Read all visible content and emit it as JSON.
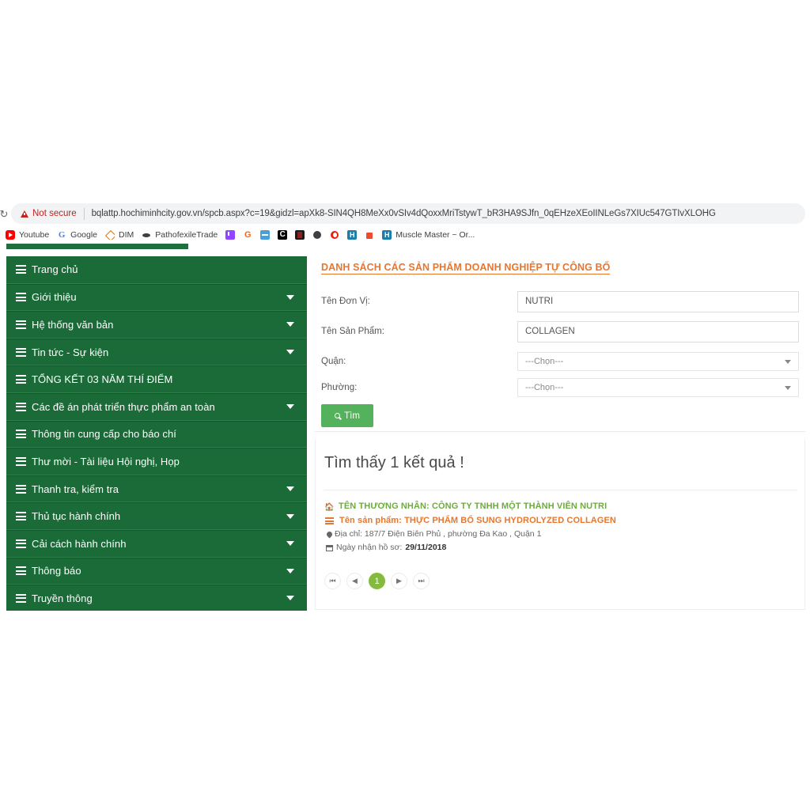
{
  "browser": {
    "reload_icon": "reload-icon",
    "security_label": "Not secure",
    "url": "bqlattp.hochiminhcity.gov.vn/spcb.aspx?c=19&gidzl=apXk8-SIN4QH8MeXx0vSIv4dQoxxMriTstywT_bR3HA9SJfn_0qEHzeXEoIINLeGs7XIUc547GTIvXLOHG",
    "bookmarks": [
      {
        "label": "Youtube",
        "icon": "youtube-icon",
        "cls": "fav-youtube",
        "glyph": ""
      },
      {
        "label": "Google",
        "icon": "google-icon",
        "cls": "fav-google",
        "glyph": "G"
      },
      {
        "label": "DIM",
        "icon": "dim-icon",
        "cls": "fav-dim",
        "glyph": ""
      },
      {
        "label": "PathofexileTrade",
        "icon": "pathofexile-icon",
        "cls": "fav-patho",
        "glyph": ""
      },
      {
        "label": "",
        "icon": "twitch-icon",
        "cls": "fav-twitch",
        "glyph": ""
      },
      {
        "label": "",
        "icon": "g2a-icon",
        "cls": "fav-g2",
        "glyph": "G"
      },
      {
        "label": "",
        "icon": "blue-site-icon",
        "cls": "fav-blue",
        "glyph": ""
      },
      {
        "label": "",
        "icon": "curseforge-icon",
        "cls": "fav-c",
        "glyph": "C"
      },
      {
        "label": "",
        "icon": "dark-site-icon",
        "cls": "fav-dark",
        "glyph": ""
      },
      {
        "label": "",
        "icon": "globe-icon",
        "cls": "fav-globe",
        "glyph": ""
      },
      {
        "label": "",
        "icon": "opera-icon",
        "cls": "fav-opera",
        "glyph": ""
      },
      {
        "label": "",
        "icon": "h-site-icon",
        "cls": "fav-h",
        "glyph": "H"
      },
      {
        "label": "",
        "icon": "shopee-icon",
        "cls": "fav-shopee",
        "glyph": ""
      },
      {
        "label": "Muscle Master ~ Or...",
        "icon": "h-site-icon-2",
        "cls": "fav-h2",
        "glyph": "H"
      }
    ]
  },
  "sidebar": {
    "items": [
      {
        "label": "Trang chủ",
        "has_caret": false
      },
      {
        "label": "Giới thiệu",
        "has_caret": true
      },
      {
        "label": "Hệ thống văn bản",
        "has_caret": true
      },
      {
        "label": "Tin tức - Sự kiện",
        "has_caret": true
      },
      {
        "label": "TỔNG KẾT 03 NĂM THÍ ĐIỂM",
        "has_caret": false
      },
      {
        "label": "Các đề án phát triển thực phẩm an toàn",
        "has_caret": true
      },
      {
        "label": "Thông tin cung cấp cho báo chí",
        "has_caret": false
      },
      {
        "label": "Thư mời - Tài liệu Hội nghị, Họp",
        "has_caret": false
      },
      {
        "label": "Thanh tra, kiểm tra",
        "has_caret": true
      },
      {
        "label": "Thủ tục hành chính",
        "has_caret": true
      },
      {
        "label": "Cải cách hành chính",
        "has_caret": true
      },
      {
        "label": "Thông báo",
        "has_caret": true
      },
      {
        "label": "Truyền thông",
        "has_caret": true
      }
    ]
  },
  "main": {
    "section_title": "DANH SÁCH CÁC SẢN PHẨM DOANH NGHIỆP TỰ CÔNG BỐ",
    "form": {
      "unit_label": "Tên Đơn Vị:",
      "unit_value": "NUTRI",
      "product_label": "Tên Sản Phẩm:",
      "product_value": "COLLAGEN",
      "district_label": "Quận:",
      "district_value": "---Chọn---",
      "ward_label": "Phường:",
      "ward_value": "---Chọn---",
      "search_button": "Tìm"
    },
    "results": {
      "heading": "Tìm thấy 1 kết quả !",
      "items": [
        {
          "merchant": "TÊN THƯƠNG NHÂN: CÔNG TY TNHH MỘT THÀNH VIÊN NUTRI",
          "product": "Tên sản phẩm: THỰC PHẨM BỔ SUNG HYDROLYZED COLLAGEN",
          "address": "Địa chỉ: 187/7 Điện Biên Phủ , phường Đa Kao , Quận 1",
          "date_label": "Ngày nhận hồ sơ:",
          "date_value": "29/11/2018"
        }
      ]
    },
    "pagination": {
      "first": "⏮",
      "prev": "◀",
      "current": "1",
      "next": "▶",
      "last": "⏭"
    }
  },
  "colors": {
    "sidebar_green": "#1b6b38",
    "accent_orange": "#e8762c",
    "merchant_green": "#6eab3e",
    "button_green": "#53b25b",
    "page_active": "#84bb3f"
  }
}
